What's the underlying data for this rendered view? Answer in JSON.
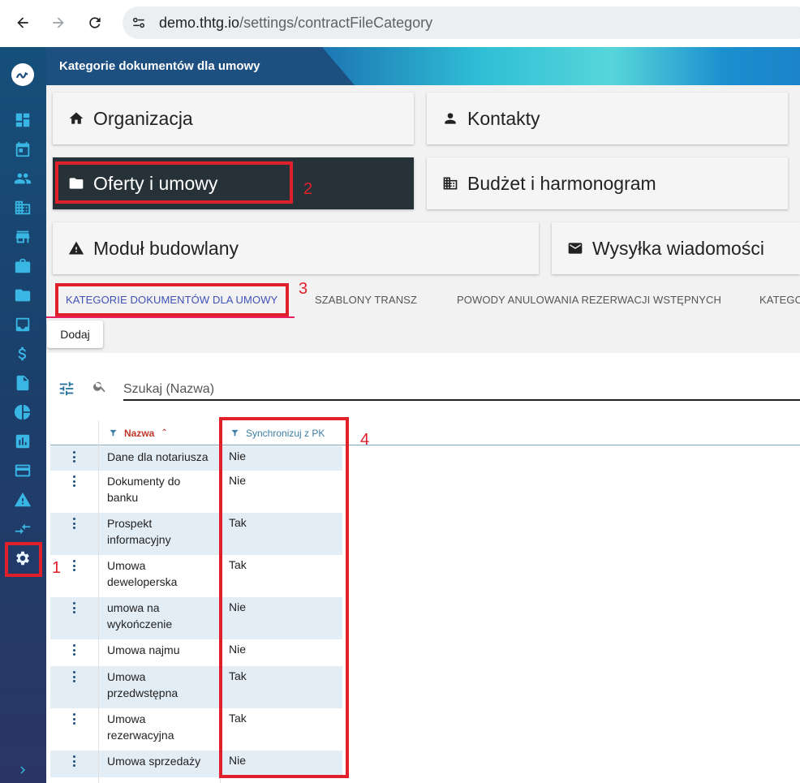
{
  "browser": {
    "url_host": "demo.thtg.io",
    "url_path": "/settings/contractFileCategory"
  },
  "header": {
    "title": "Kategorie dokumentów dla umowy"
  },
  "tiles": [
    {
      "label": "Organizacja",
      "icon": "home-icon"
    },
    {
      "label": "Kontakty",
      "icon": "person-icon"
    },
    {
      "label": "Oferty i umowy",
      "icon": "folder-icon"
    },
    {
      "label": "Budżet i harmonogram",
      "icon": "building-icon"
    },
    {
      "label": "Moduł budowlany",
      "icon": "warning-icon"
    },
    {
      "label": "Wysyłka wiadomości",
      "icon": "mail-icon"
    }
  ],
  "tabs": [
    {
      "label": "KATEGORIE DOKUMENTÓW DLA UMOWY",
      "active": true
    },
    {
      "label": "SZABLONY TRANSZ"
    },
    {
      "label": "POWODY ANULOWANIA REZERWACJI WSTĘPNYCH"
    },
    {
      "label": "KATEGO"
    }
  ],
  "toolbar": {
    "add_label": "Dodaj"
  },
  "search": {
    "placeholder": "Szukaj (Nazwa)"
  },
  "table": {
    "columns": [
      {
        "label": "Nazwa",
        "sort": "asc"
      },
      {
        "label": "Synchronizuj z PK"
      }
    ],
    "rows": [
      {
        "name": "Dane dla notariusza",
        "sync": "Nie"
      },
      {
        "name": "Dokumenty do banku",
        "sync": "Nie"
      },
      {
        "name": "Prospekt informacyjny",
        "sync": "Tak"
      },
      {
        "name": "Umowa deweloperska",
        "sync": "Tak"
      },
      {
        "name": "umowa na wykończenie",
        "sync": "Nie"
      },
      {
        "name": "Umowa najmu",
        "sync": "Nie"
      },
      {
        "name": "Umowa przedwstępna",
        "sync": "Tak"
      },
      {
        "name": "Umowa rezerwacyjna",
        "sync": "Tak"
      },
      {
        "name": "Umowa sprzedaży",
        "sync": "Nie"
      }
    ]
  },
  "annotations": [
    "1",
    "2",
    "3",
    "4"
  ],
  "colors": {
    "annotation": "#e0202b",
    "active_tile": "#263238",
    "sidebar_icon": "#39b6e3",
    "active_tab": "#3f51b5",
    "name_header": "#c0392b",
    "row_alt": "#e3edf5"
  }
}
